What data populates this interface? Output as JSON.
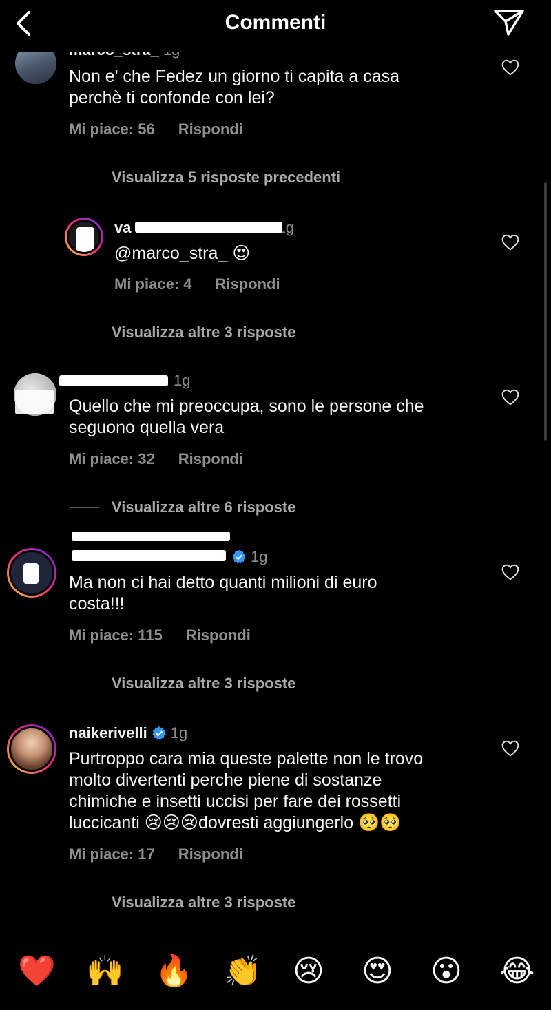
{
  "header": {
    "title": "Commenti"
  },
  "comments": [
    {
      "username": "marco_stra_",
      "time": "1g",
      "text_line1": "Non e' che Fedez un giorno ti capita a casa",
      "text_line2": "perchè ti confonde con lei?",
      "likes": "Mi piace: 56",
      "reply": "Rispondi"
    },
    {
      "view_more": "Visualizza 5 risposte precedenti"
    },
    {
      "username_visible": "va",
      "time": "1g",
      "mention": "@marco_stra_",
      "emoji": "😍",
      "likes": "Mi piace: 4",
      "reply": "Rispondi"
    },
    {
      "view_more": "Visualizza altre 3 risposte"
    },
    {
      "time": "1g",
      "text_line1": "Quello che mi preoccupa, sono le persone che",
      "text_line2": "seguono quella vera",
      "likes": "Mi piace: 32",
      "reply": "Rispondi"
    },
    {
      "view_more": "Visualizza altre 6 risposte"
    },
    {
      "time": "1g",
      "text_line1": "Ma non ci hai detto quanti milioni di euro",
      "text_line2": "costa!!!",
      "likes": "Mi piace: 115",
      "reply": "Rispondi"
    },
    {
      "view_more": "Visualizza altre 3 risposte"
    },
    {
      "username": "naikerivelli",
      "time": "1g",
      "text_line1": "Purtroppo cara mia queste palette non le trovo",
      "text_line2": "molto divertenti perche piene di sostanze",
      "text_line3": "chimiche e insetti uccisi per fare dei rossetti",
      "text_line4": "luccicanti 😢😢😢dovresti aggiungerlo 🥺🥺",
      "likes": "Mi piace: 17",
      "reply": "Rispondi"
    },
    {
      "view_more": "Visualizza altre 3 risposte"
    }
  ],
  "emoji_bar": [
    "❤️",
    "🙌",
    "🔥",
    "👏",
    "😢",
    "😍",
    "😮",
    "😂"
  ],
  "colors": {
    "background": "#000000",
    "text": "#f5f5f5",
    "muted": "#8e8e8e",
    "verified": "#3897f0"
  }
}
